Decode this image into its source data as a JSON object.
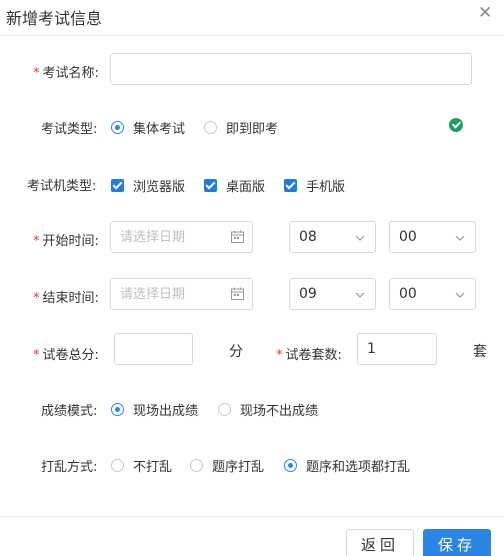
{
  "dialog": {
    "title": "新增考试信息"
  },
  "form": {
    "exam_name": {
      "label": "考试名称:",
      "value": ""
    },
    "exam_type": {
      "label": "考试类型:",
      "options": [
        "集体考试",
        "即到即考"
      ],
      "selected": "集体考试"
    },
    "machine_type": {
      "label": "考试机类型:",
      "options": [
        "浏览器版",
        "桌面版",
        "手机版"
      ]
    },
    "start_time": {
      "label": "开始时间:",
      "date_placeholder": "请选择日期",
      "hour": "08",
      "minute": "00"
    },
    "end_time": {
      "label": "结束时间:",
      "date_placeholder": "请选择日期",
      "hour": "09",
      "minute": "00"
    },
    "total_score": {
      "label": "试卷总分:",
      "value": "",
      "unit": "分"
    },
    "paper_sets": {
      "label": "试卷套数:",
      "value": "1",
      "unit": "套"
    },
    "score_mode": {
      "label": "成绩模式:",
      "options": [
        "现场出成绩",
        "现场不出成绩"
      ],
      "selected": "现场出成绩"
    },
    "shuffle_mode": {
      "label": "打乱方式:",
      "options": [
        "不打乱",
        "题序打乱",
        "题序和选项都打乱"
      ],
      "selected": "题序和选项都打乱"
    }
  },
  "footer": {
    "back_label": "返回",
    "save_label": "保存"
  },
  "colors": {
    "accent": "#2b85e4",
    "required": "#e4393c",
    "success": "#19a15f"
  }
}
